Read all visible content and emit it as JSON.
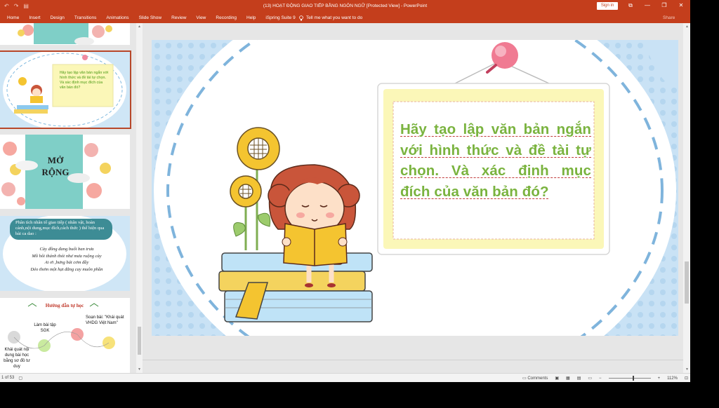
{
  "titlebar": {
    "title": "(13) HOẠT ĐỘNG GIAO TIẾP BẰNG NGÔN NGỮ [Protected View]  -  PowerPoint",
    "sign_in": "Sign in",
    "qat": [
      "↶",
      "↷",
      "▤"
    ],
    "controls": [
      "⧉",
      "—",
      "❐",
      "✕"
    ]
  },
  "ribbon": {
    "tabs": [
      "Home",
      "Insert",
      "Design",
      "Transitions",
      "Animations",
      "Slide Show",
      "Review",
      "View",
      "Recording",
      "Help",
      "iSpring Suite 9"
    ],
    "tell_me": "Tell me what you want to do",
    "share": "Share"
  },
  "thumbnails": {
    "slide2_text": "Hãy tạo lập văn bản ngắn với hình thức và đề tài tự chọn. Và xác định mục đích của văn bản đó?",
    "slide3_title_1": "MỞ",
    "slide3_title_2": "RỘNG",
    "slide4_header": "Phân tích nhân tố giao tiếp ( nhân vật, hoàn cảnh,nội dung,mục đích,cách thức ) thể hiện qua bài ca dao :",
    "slide4_poem": [
      "Cày đồng đang buổi ban trưa",
      "Mồ hôi thánh thót như mưa ruộng cày",
      "Ai ơi ,bưng bát cơm đầy",
      "Dẻo thơm một hạt đắng cay muôn phần"
    ],
    "slide5_title": "Hướng dẫn tự học",
    "slide5_left1": "Làm bài tập SGK",
    "slide5_left2": "Khái quát nội dung bài học bằng sơ đồ tư duy",
    "slide5_right": "Soạn bài: \"Khái quát VHDG Việt Nam\""
  },
  "slide": {
    "text": [
      "Hãy tạo lập văn bản ngắn",
      "với hình thức và đề tài tự",
      "chọn. Và xác định mục",
      "đích của văn bản đó?"
    ]
  },
  "status": {
    "slide_counter": "1 of 53",
    "comments": "Comments",
    "zoom": "112%"
  },
  "colors": {
    "accent": "#c43e1c",
    "slide_text": "#7ab33f"
  }
}
